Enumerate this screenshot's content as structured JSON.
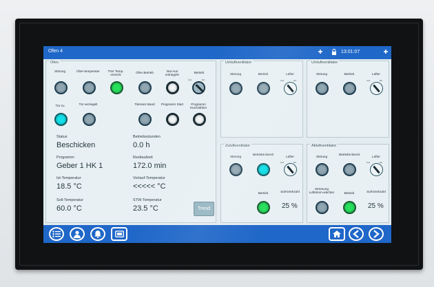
{
  "window": {
    "title": "Ofen 4",
    "time": "13:01:07",
    "icons": [
      "plus-shield-icon",
      "lock-icon",
      "plus-shield-icon"
    ]
  },
  "ofen": {
    "group_title": "Ofen",
    "row1": [
      {
        "label": "Störung",
        "state": "grey"
      },
      {
        "label": "Über-temperatur",
        "state": "grey"
      },
      {
        "label": "TNV Temp. erreicht",
        "state": "green"
      },
      {
        "label": "Ofen Betrieb",
        "state": "grey"
      },
      {
        "label": "Not-Aus entriegeln",
        "state": "white"
      },
      {
        "label": "Betrieb",
        "state": "knob"
      }
    ],
    "row2": [
      {
        "label": "Tür zu",
        "state": "cyan"
      },
      {
        "label": "Tür verriegelt",
        "state": "grey"
      },
      {
        "label": "Toleranz Band",
        "state": "grey"
      },
      {
        "label": "Programm Start",
        "state": "white"
      },
      {
        "label": "Programm Hochzählen",
        "state": "white"
      }
    ],
    "status_label": "Status",
    "status_value": "Beschicken",
    "betriebsstunden_label": "Betriebsstunden",
    "betriebsstunden_value": "0.0 h",
    "programm_label": "Programm",
    "programm_value": "Geber 1 HK 1",
    "restlaufzeit_label": "Restlaufzeit",
    "restlaufzeit_value": "172.0 min",
    "ist_temp_label": "Ist-Temperatur",
    "ist_temp_value": "18.5 °C",
    "vorlauf_temp_label": "Vorlauf-Temperatur",
    "vorlauf_temp_value": "<<<<< °C",
    "soll_temp_label": "Soll-Temperatur",
    "soll_temp_value": "60.0 °C",
    "stw_temp_label": "STW-Temperatur",
    "stw_temp_value": "23.5 °C",
    "trend_button": "Trend"
  },
  "umluft1": {
    "title": "Umluftventilator",
    "stoerung": "Störung",
    "betrieb": "Betrieb",
    "luefter": "Lüfter",
    "aus": "Aus",
    "ein": "Ein"
  },
  "umluft2": {
    "title": "Umluftventilator",
    "stoerung": "Störung",
    "betrieb": "Betrieb",
    "luefter": "Lüfter",
    "aus": "Aus",
    "ein": "Ein"
  },
  "zuluft": {
    "title": "Zuluftventilator",
    "stoerung": "Störung",
    "bereit": "Betriebs-bereit",
    "luefter": "Lüfter",
    "betrieb": "Betrieb",
    "soll_label": "Soll-Drehzahl",
    "soll_value": "25 %",
    "aus": "Aus",
    "ein": "Ein"
  },
  "abluft": {
    "title": "Abluftventilator",
    "stoerung": "Störung",
    "bereit": "Betriebs-bereit",
    "luefter": "Lüfter",
    "stroemung": "Strömung Luftstrom-wächter",
    "betrieb": "Betrieb",
    "soll_label": "Soll-Drehzahl",
    "soll_value": "25 %",
    "aus": "Aus",
    "ein": "Ein"
  },
  "nav": {
    "left": [
      "list-menu-icon",
      "user-icon",
      "alarm-bell-icon",
      "screen-icon"
    ],
    "right": [
      "home-icon",
      "back-arrow-icon",
      "forward-arrow-icon"
    ]
  },
  "colors": {
    "accent": "#1f67c8",
    "lamp_green": "#27e05c",
    "lamp_cyan": "#12e0e8",
    "lamp_grey": "#90a7b3"
  }
}
